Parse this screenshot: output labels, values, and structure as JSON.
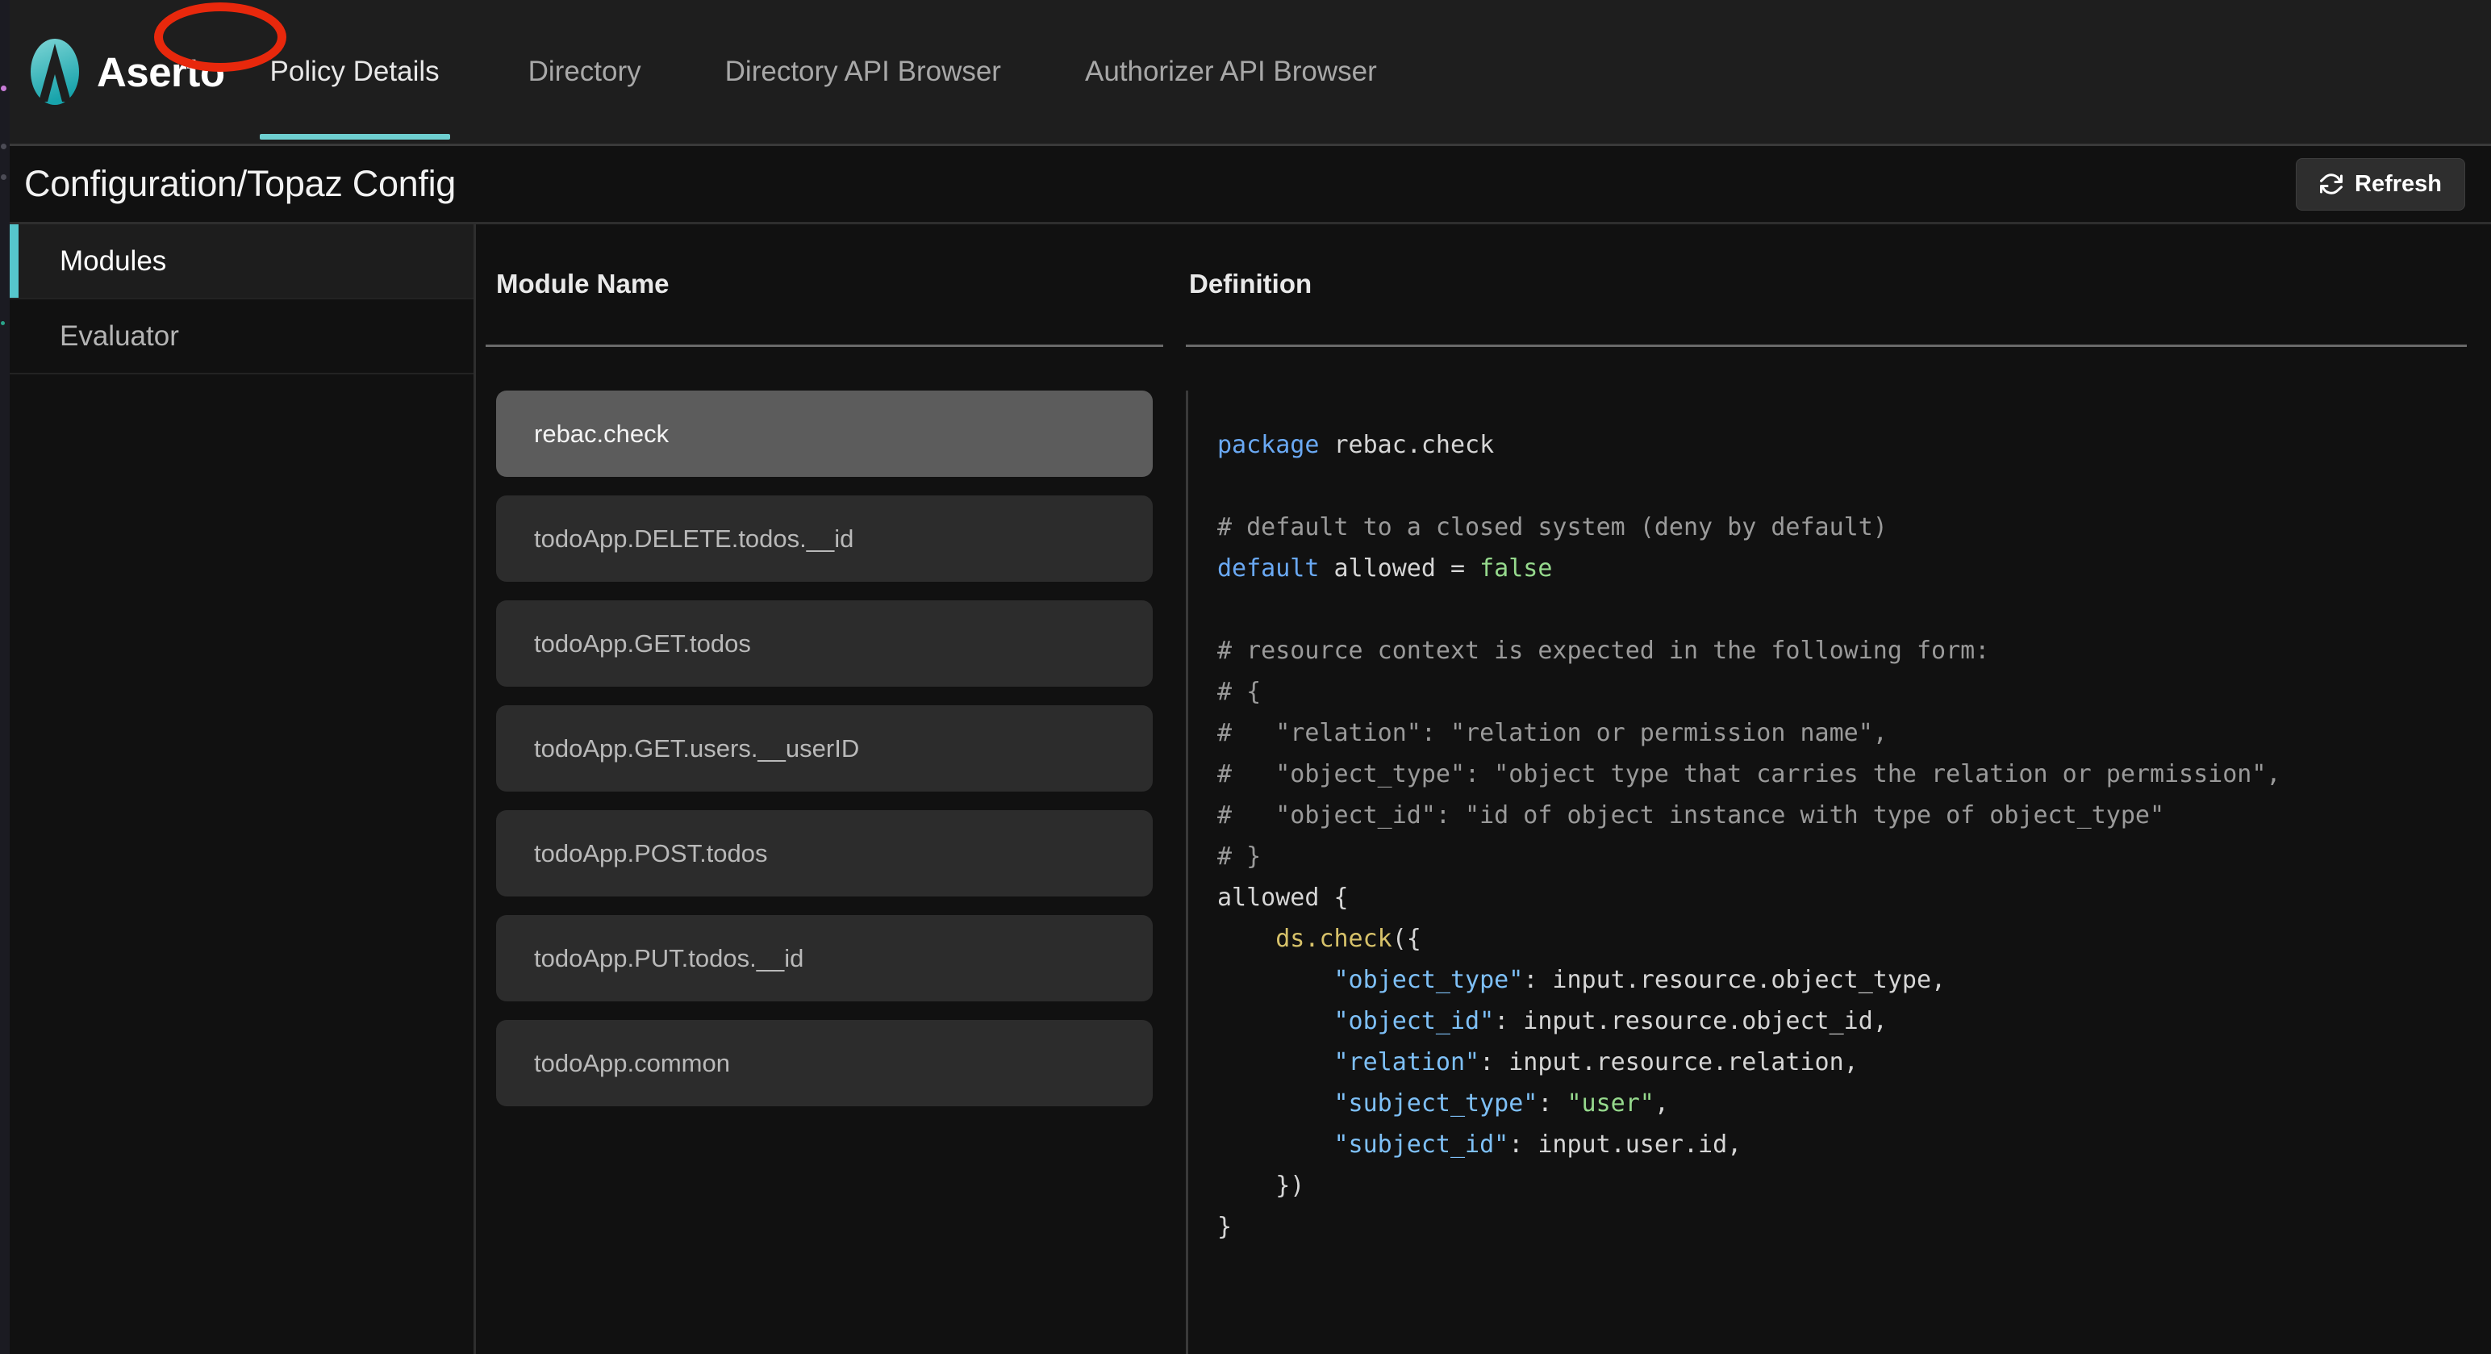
{
  "brand": {
    "name": "Aserto",
    "logo_icon": "aserto-logo-icon"
  },
  "topnav": {
    "items": [
      {
        "label": "Policy Details",
        "active": true
      },
      {
        "label": "Directory",
        "active": false
      },
      {
        "label": "Directory API Browser",
        "active": false
      },
      {
        "label": "Authorizer API Browser",
        "active": false
      }
    ],
    "annotation": {
      "shape": "ellipse",
      "color": "#e8280c",
      "target": "Policy Details"
    },
    "active_underline_color": "#6ecfd0"
  },
  "header": {
    "title": "Configuration/Topaz Config",
    "refresh_label": "Refresh",
    "refresh_icon": "refresh-icon"
  },
  "sidebar": {
    "items": [
      {
        "label": "Modules",
        "active": true
      },
      {
        "label": "Evaluator",
        "active": false
      }
    ],
    "active_indicator_color": "#56c6cc"
  },
  "modules_panel": {
    "column_header": "Module Name",
    "items": [
      {
        "name": "rebac.check",
        "selected": true
      },
      {
        "name": "todoApp.DELETE.todos.__id",
        "selected": false
      },
      {
        "name": "todoApp.GET.todos",
        "selected": false
      },
      {
        "name": "todoApp.GET.users.__userID",
        "selected": false
      },
      {
        "name": "todoApp.POST.todos",
        "selected": false
      },
      {
        "name": "todoApp.PUT.todos.__id",
        "selected": false
      },
      {
        "name": "todoApp.common",
        "selected": false
      }
    ]
  },
  "definition_panel": {
    "column_header": "Definition",
    "language": "rego",
    "code_lines": [
      [
        {
          "t": "package",
          "c": "kw"
        },
        {
          "t": " rebac.check",
          "c": "plain"
        }
      ],
      [
        {
          "t": "",
          "c": "plain"
        }
      ],
      [
        {
          "t": "# default to a closed system (deny by default)",
          "c": "comment"
        }
      ],
      [
        {
          "t": "default",
          "c": "kw"
        },
        {
          "t": " allowed = ",
          "c": "plain"
        },
        {
          "t": "false",
          "c": "bool"
        }
      ],
      [
        {
          "t": "",
          "c": "plain"
        }
      ],
      [
        {
          "t": "# resource context is expected in the following form:",
          "c": "comment"
        }
      ],
      [
        {
          "t": "# {",
          "c": "comment"
        }
      ],
      [
        {
          "t": "#   \"relation\": \"relation or permission name\",",
          "c": "comment"
        }
      ],
      [
        {
          "t": "#   \"object_type\": \"object type that carries the relation or permission\",",
          "c": "comment"
        }
      ],
      [
        {
          "t": "#   \"object_id\": \"id of object instance with type of object_type\"",
          "c": "comment"
        }
      ],
      [
        {
          "t": "# }",
          "c": "comment"
        }
      ],
      [
        {
          "t": "allowed {",
          "c": "plain"
        }
      ],
      [
        {
          "t": "    ",
          "c": "plain"
        },
        {
          "t": "ds",
          "c": "fn"
        },
        {
          "t": ".",
          "c": "fn"
        },
        {
          "t": "check",
          "c": "fn"
        },
        {
          "t": "({",
          "c": "plain"
        }
      ],
      [
        {
          "t": "        ",
          "c": "plain"
        },
        {
          "t": "\"object_type\"",
          "c": "key"
        },
        {
          "t": ": input.resource.object_type,",
          "c": "plain"
        }
      ],
      [
        {
          "t": "        ",
          "c": "plain"
        },
        {
          "t": "\"object_id\"",
          "c": "key"
        },
        {
          "t": ": input.resource.object_id,",
          "c": "plain"
        }
      ],
      [
        {
          "t": "        ",
          "c": "plain"
        },
        {
          "t": "\"relation\"",
          "c": "key"
        },
        {
          "t": ": input.resource.relation,",
          "c": "plain"
        }
      ],
      [
        {
          "t": "        ",
          "c": "plain"
        },
        {
          "t": "\"subject_type\"",
          "c": "key"
        },
        {
          "t": ": ",
          "c": "plain"
        },
        {
          "t": "\"user\"",
          "c": "str"
        },
        {
          "t": ",",
          "c": "plain"
        }
      ],
      [
        {
          "t": "        ",
          "c": "plain"
        },
        {
          "t": "\"subject_id\"",
          "c": "key"
        },
        {
          "t": ": input.user.id,",
          "c": "plain"
        }
      ],
      [
        {
          "t": "    })",
          "c": "plain"
        }
      ],
      [
        {
          "t": "}",
          "c": "plain"
        }
      ]
    ]
  },
  "colors": {
    "accent_teal": "#56c6cc",
    "annotation_red": "#e8280c",
    "nav_background": "#1e1e1e",
    "page_background": "#111111",
    "card_selected": "#5c5c5c",
    "card_default": "#2c2c2c"
  }
}
